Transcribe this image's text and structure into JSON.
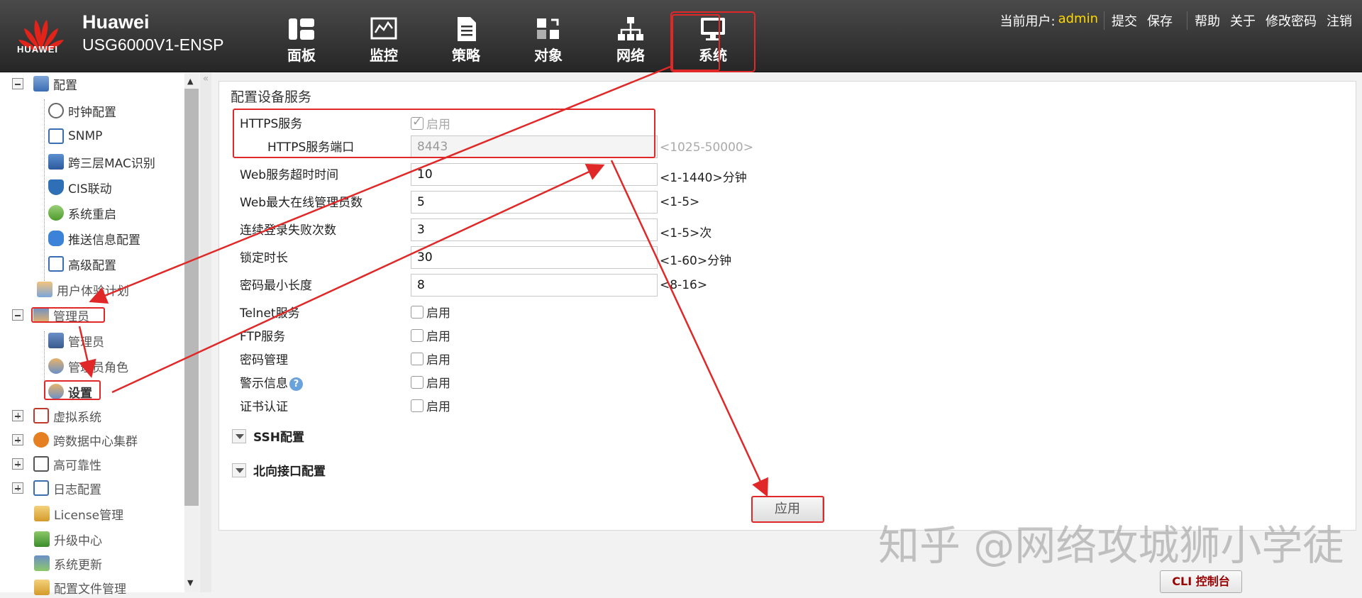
{
  "brand": {
    "logo_text": "HUAWEI",
    "name": "Huawei",
    "model": "USG6000V1-ENSP"
  },
  "nav": [
    {
      "label": "面板",
      "icon": "dashboard-icon"
    },
    {
      "label": "监控",
      "icon": "monitor-icon"
    },
    {
      "label": "策略",
      "icon": "policy-icon"
    },
    {
      "label": "对象",
      "icon": "object-icon"
    },
    {
      "label": "网络",
      "icon": "network-icon"
    },
    {
      "label": "系统",
      "icon": "system-icon",
      "active": true
    }
  ],
  "userbar": {
    "current_user_label": "当前用户:",
    "username": "admin",
    "submit": "提交",
    "save": "保存",
    "help": "帮助",
    "about": "关于",
    "change_password": "修改密码",
    "logout": "注销"
  },
  "sidebar": {
    "items": [
      {
        "label": "配置"
      },
      {
        "label": "时钟配置"
      },
      {
        "label": "SNMP"
      },
      {
        "label": "跨三层MAC识别"
      },
      {
        "label": "CIS联动"
      },
      {
        "label": "系统重启"
      },
      {
        "label": "推送信息配置"
      },
      {
        "label": "高级配置"
      },
      {
        "label": "用户体验计划"
      },
      {
        "label": "管理员"
      },
      {
        "label": "管理员"
      },
      {
        "label": "管理员角色"
      },
      {
        "label": "设置"
      },
      {
        "label": "虚拟系统"
      },
      {
        "label": "跨数据中心集群"
      },
      {
        "label": "高可靠性"
      },
      {
        "label": "日志配置"
      },
      {
        "label": "License管理"
      },
      {
        "label": "升级中心"
      },
      {
        "label": "系统更新"
      },
      {
        "label": "配置文件管理"
      }
    ]
  },
  "panel": {
    "title": "配置设备服务",
    "https_service": {
      "label": "HTTPS服务",
      "checkbox": "启用",
      "checked": true
    },
    "https_port": {
      "label": "HTTPS服务端口",
      "value": "8443",
      "hint": "<1025-50000>"
    },
    "web_timeout": {
      "label": "Web服务超时时间",
      "value": "10",
      "hint": "<1-1440>分钟"
    },
    "web_max_admins": {
      "label": "Web最大在线管理员数",
      "value": "5",
      "hint": "<1-5>"
    },
    "login_fail": {
      "label": "连续登录失败次数",
      "value": "3",
      "hint": "<1-5>次"
    },
    "lock_duration": {
      "label": "锁定时长",
      "value": "30",
      "hint": "<1-60>分钟"
    },
    "pwd_min_len": {
      "label": "密码最小长度",
      "value": "8",
      "hint": "<8-16>"
    },
    "telnet": {
      "label": "Telnet服务",
      "checkbox": "启用"
    },
    "ftp": {
      "label": "FTP服务",
      "checkbox": "启用"
    },
    "pwd_mgmt": {
      "label": "密码管理",
      "checkbox": "启用"
    },
    "warning": {
      "label": "警示信息",
      "checkbox": "启用"
    },
    "cert_auth": {
      "label": "证书认证",
      "checkbox": "启用"
    },
    "ssh_section": "SSH配置",
    "northbound_section": "北向接口配置",
    "apply": "应用"
  },
  "cli_console": "CLI 控制台",
  "watermark": "知乎 @网络攻城狮小学徒",
  "colors": {
    "highlight": "#e02828",
    "username": "#ffd800",
    "topbar": "#333333"
  }
}
